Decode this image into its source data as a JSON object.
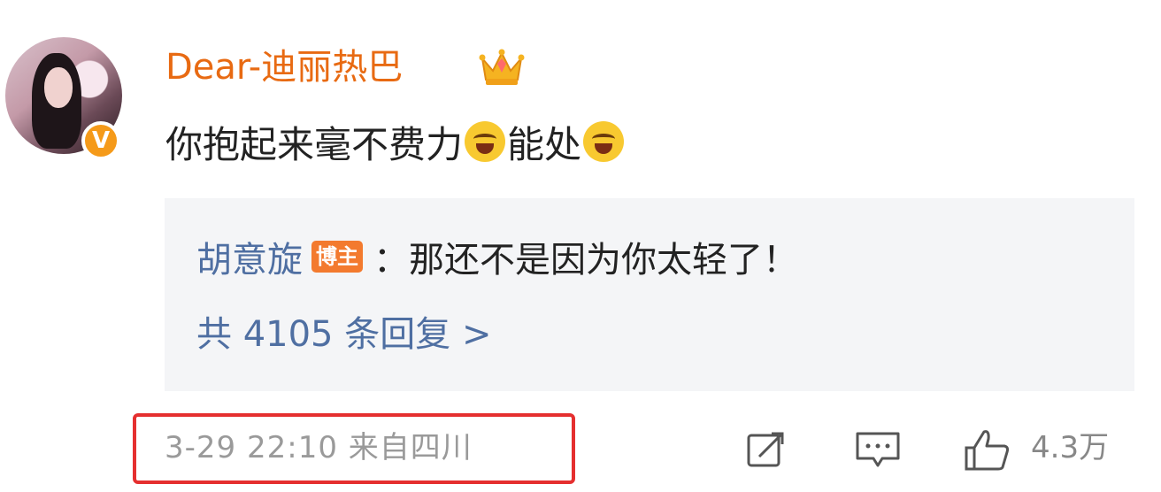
{
  "comment": {
    "username": "Dear-迪丽热巴",
    "verified_badge": "V",
    "text_part1": "你抱起来毫不费力",
    "emoji1": "laughing-tears-emoji",
    "text_part2": "能处",
    "emoji2": "laughing-emoji"
  },
  "reply": {
    "author": "胡意旋",
    "badge": "博主",
    "separator": "：",
    "text": "那还不是因为你太轻了！",
    "count_label": "共 4105 条回复 >"
  },
  "footer": {
    "timestamp": "3-29 22:10  来自四川",
    "likes": "4.3万"
  },
  "colors": {
    "username": "#e86a12",
    "link": "#4f6fa2",
    "highlight_frame": "#e52f2f",
    "badge": "#f37a2e",
    "verified": "#f59a19"
  },
  "icons": [
    "crown-icon",
    "repost-icon",
    "comment-icon",
    "like-icon"
  ]
}
